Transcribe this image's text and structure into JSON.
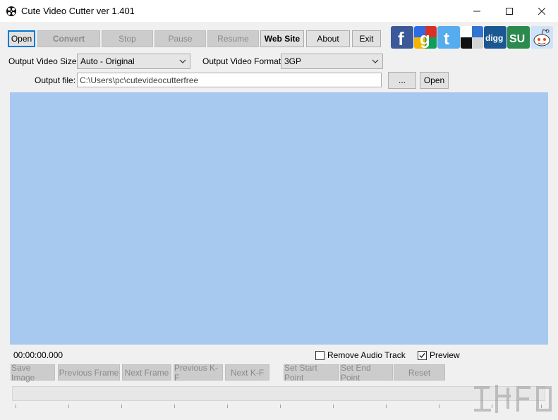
{
  "window": {
    "title": "Cute Video Cutter ver 1.401",
    "minimize": "minimize",
    "maximize": "maximize",
    "close": "close"
  },
  "toolbar": {
    "open": "Open",
    "convert": "Convert",
    "stop": "Stop",
    "pause": "Pause",
    "resume": "Resume",
    "website": "Web Site",
    "about": "About",
    "exit": "Exit"
  },
  "social": [
    {
      "name": "facebook-icon",
      "glyph": "f",
      "color": "#3b5998"
    },
    {
      "name": "google-icon",
      "glyph": "g",
      "color": "#ffffff"
    },
    {
      "name": "twitter-icon",
      "glyph": "t",
      "color": "#55acee"
    },
    {
      "name": "delicious-icon",
      "glyph": "",
      "color": "#ffffff"
    },
    {
      "name": "digg-icon",
      "glyph": "digg",
      "color": "#1b5891"
    },
    {
      "name": "stumbleupon-icon",
      "glyph": "SU",
      "color": "#2d8a4e"
    },
    {
      "name": "reddit-icon",
      "glyph": "",
      "color": "#cee3f8"
    }
  ],
  "settings": {
    "size_label": "Output Video Size:",
    "size_value": "Auto - Original",
    "format_label": "Output Video Format:",
    "format_value": "3GP",
    "file_label": "Output file:",
    "file_value": "C:\\Users\\pc\\cutevideocutterfree",
    "browse": "...",
    "open": "Open"
  },
  "status": {
    "time": "00:00:00.000",
    "remove_audio": "Remove Audio Track",
    "remove_audio_checked": false,
    "preview": "Preview",
    "preview_checked": true
  },
  "bottom_buttons": {
    "save_image": "Save Image",
    "previous_frame": "Previous Frame",
    "next_frame": "Next Frame",
    "previous_kf": "Previous K-F",
    "next_kf": "Next K-F",
    "set_start": "Set  Start Point",
    "set_end": "Set  End Point",
    "reset": "Reset"
  },
  "colors": {
    "preview_bg": "#a8c9ef",
    "focus_border": "#0078d7"
  }
}
